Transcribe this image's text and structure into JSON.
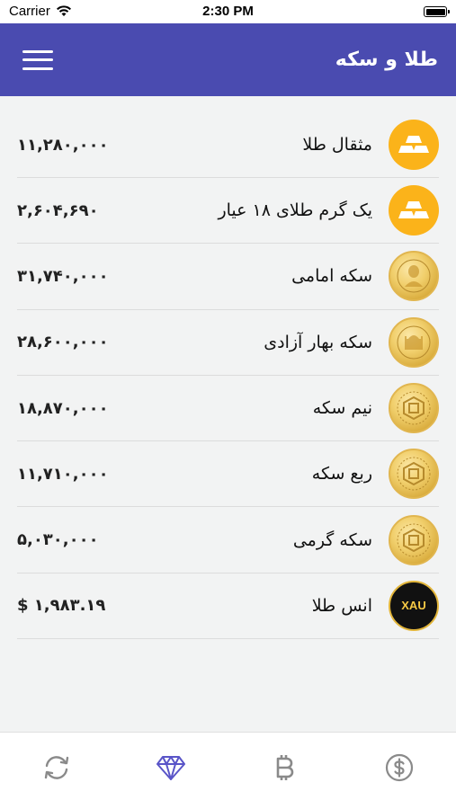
{
  "status": {
    "carrier": "Carrier",
    "time": "2:30 PM"
  },
  "header": {
    "title": "طلا و سکه"
  },
  "items": [
    {
      "name": "مثقال طلا",
      "price": "۱۱,۲۸۰,۰۰۰",
      "icon": "gold-bars-icon"
    },
    {
      "name": "یک گرم طلای ۱۸ عیار",
      "price": "۲,۶۰۴,۶۹۰",
      "icon": "gold-bars-icon"
    },
    {
      "name": "سکه امامی",
      "price": "۳۱,۷۴۰,۰۰۰",
      "icon": "emami-coin-icon"
    },
    {
      "name": "سکه بهار آزادی",
      "price": "۲۸,۶۰۰,۰۰۰",
      "icon": "bahar-azadi-coin-icon"
    },
    {
      "name": "نیم سکه",
      "price": "۱۸,۸۷۰,۰۰۰",
      "icon": "half-coin-icon"
    },
    {
      "name": "ربع سکه",
      "price": "۱۱,۷۱۰,۰۰۰",
      "icon": "quarter-coin-icon"
    },
    {
      "name": "سکه گرمی",
      "price": "۵,۰۳۰,۰۰۰",
      "icon": "gram-coin-icon"
    },
    {
      "name": "انس طلا",
      "price": "$ ۱,۹۸۳.۱۹",
      "icon": "xau-icon",
      "badge": "XAU"
    }
  ],
  "tabs": [
    {
      "name": "exchange-icon",
      "active": false
    },
    {
      "name": "diamond-icon",
      "active": true
    },
    {
      "name": "bitcoin-icon",
      "active": false
    },
    {
      "name": "dollar-icon",
      "active": false
    }
  ],
  "colors": {
    "header": "#4a4bb0",
    "active_tab": "#5a55c8",
    "inactive_tab": "#8a8a8a",
    "gold": "#fbb31a"
  }
}
